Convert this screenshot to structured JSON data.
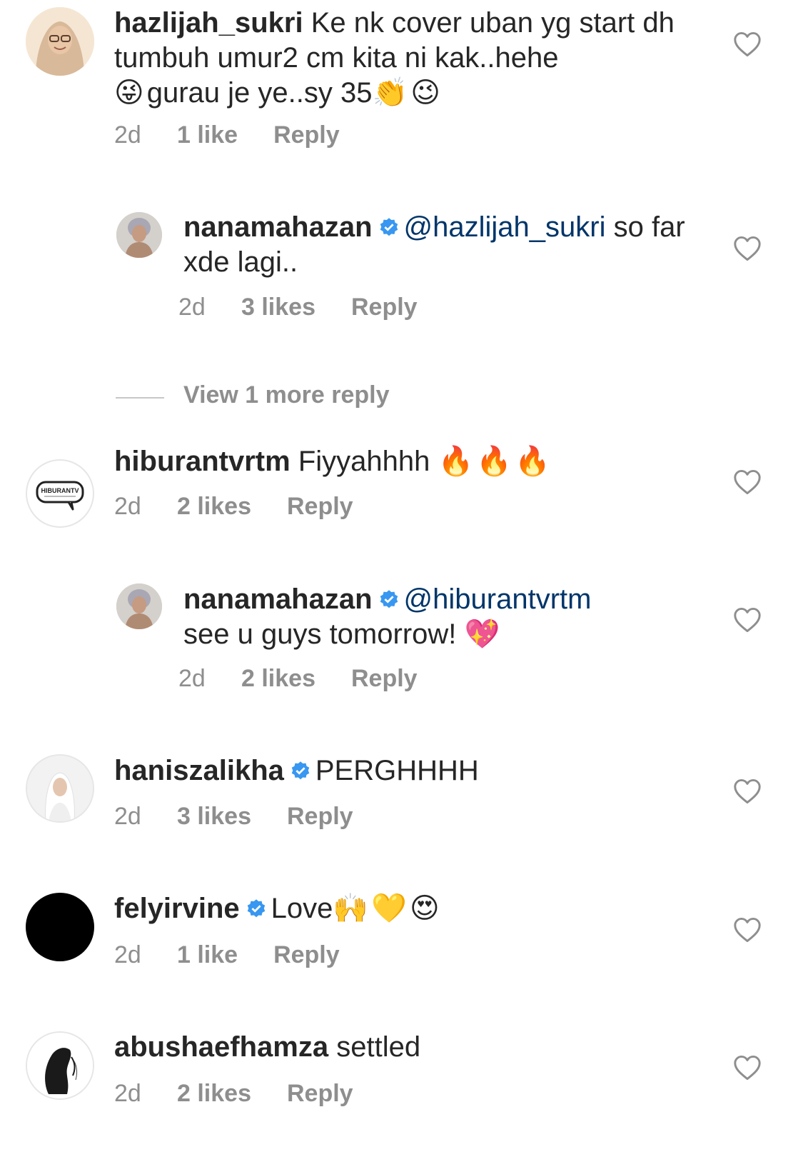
{
  "comments": [
    {
      "username": "hazlijah_sukri",
      "verified": false,
      "text": "Ke nk cover uban yg start dh tumbuh umur2 cm kita ni kak..hehe",
      "text2": "gurau je ye..sy 35",
      "emoji_a": "😜",
      "emoji_b": "👏😉",
      "time": "2d",
      "likes": "1 like",
      "reply_label": "Reply"
    },
    {
      "username": "nanamahazan",
      "verified": true,
      "mention": "@hazlijah_sukri",
      "text": "so far xde lagi..",
      "time": "2d",
      "likes": "3 likes",
      "reply_label": "Reply"
    },
    {
      "username": "hiburantvrtm",
      "verified": false,
      "text": "Fiyyahhhh",
      "emoji": "🔥🔥🔥",
      "avatar_text": "HIBURANTV",
      "time": "2d",
      "likes": "2 likes",
      "reply_label": "Reply"
    },
    {
      "username": "nanamahazan",
      "verified": true,
      "mention": "@hiburantvrtm",
      "text": "see u guys tomorrow!",
      "emoji": "💖",
      "time": "2d",
      "likes": "2 likes",
      "reply_label": "Reply"
    },
    {
      "username": "haniszalikha",
      "verified": true,
      "text": "PERGHHHH",
      "time": "2d",
      "likes": "3 likes",
      "reply_label": "Reply"
    },
    {
      "username": "felyirvine",
      "verified": true,
      "text": "Love",
      "emoji": "🙌💛😍",
      "time": "2d",
      "likes": "1 like",
      "reply_label": "Reply"
    },
    {
      "username": "abushaefhamza",
      "verified": false,
      "text": "settled",
      "time": "2d",
      "likes": "2 likes",
      "reply_label": "Reply"
    }
  ],
  "view_more": "View 1 more reply",
  "colors": {
    "text": "#262626",
    "secondary": "#8e8e8e",
    "mention": "#003569",
    "verified": "#3897f0"
  },
  "icons": {
    "like": "heart-outline-icon",
    "verified": "verified-badge-icon"
  }
}
